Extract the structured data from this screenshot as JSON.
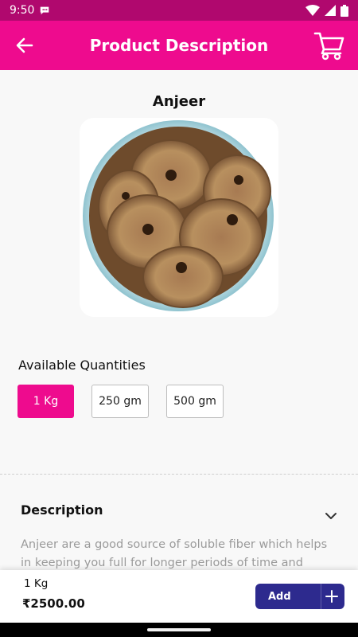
{
  "status_bar": {
    "time": "9:50"
  },
  "header": {
    "title": "Product Description"
  },
  "product": {
    "name": "Anjeer"
  },
  "quantities": {
    "label": "Available Quantities",
    "options": [
      "1 Kg",
      "250 gm",
      "500 gm"
    ],
    "selected": "1 Kg"
  },
  "description": {
    "title": "Description",
    "text": "Anjeer are a good source of soluble fiber which helps in keeping you full for longer periods of time and relieves"
  },
  "cart_bar": {
    "quantity": "1 Kg",
    "price": "₹2500.00",
    "add_label": "Add"
  },
  "colors": {
    "status_bar": "#b0086e",
    "brand_pink": "#ee0b8e",
    "add_button": "#2d2a8e"
  }
}
